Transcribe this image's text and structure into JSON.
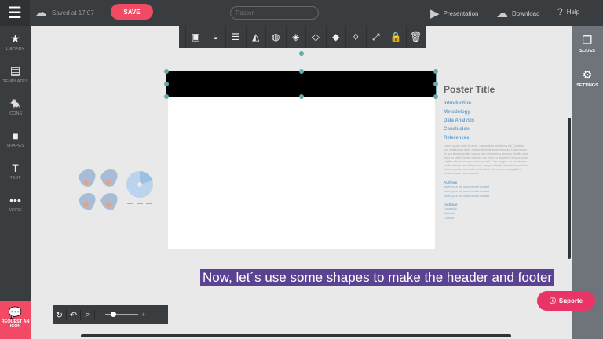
{
  "topbar": {
    "saved": "Saved at 17:07",
    "save": "SAVE",
    "title_placeholder": "Poster",
    "presentation": "Presentation",
    "download": "Download",
    "help": "Help"
  },
  "left_sidebar": [
    {
      "label": "LIBRARY",
      "icon": "★"
    },
    {
      "label": "TEMPLATES",
      "icon": "▤"
    },
    {
      "label": "ICONS",
      "icon": "🐁"
    },
    {
      "label": "SHAPES",
      "icon": "■"
    },
    {
      "label": "TEXT",
      "icon": "T"
    },
    {
      "label": "MORE",
      "icon": "•••"
    }
  ],
  "request_icon": "REQUEST AN ICON",
  "right_sidebar": [
    {
      "label": "SLIDES",
      "icon": "❐"
    },
    {
      "label": "SETTINGS",
      "icon": "⚙"
    }
  ],
  "toolbar_icons": [
    "image-icon",
    "fill-icon",
    "border-icon",
    "flip-icon",
    "opacity-icon",
    "bring-front-icon",
    "bring-forward-icon",
    "send-backward-icon",
    "send-back-icon",
    "resize-icon",
    "lock-icon",
    "delete-icon"
  ],
  "poster": {
    "title": "Poster Title",
    "sections": [
      "Introduction",
      "Metodology",
      "Data Analysis",
      "Conclusion",
      "References"
    ],
    "body": "Lorem ipsum dolor sit amet, consectetur adipiscing elit. Curabitur non malesuada dolor. Suspendisse sit amet ex turpis. Duis congue, mi non tempor mollis, massa sem dictum eros, tempus fringilla diam dolor eu tortor. Donec egestas nec enim eu tincidunt. Nunc nunc mi, sagittis a tincidunt quis, varius at velit. Duis congue, mi non tempor mollis, massa sem dictum eros, tempus fringilla diam dolor eu tortor. Donec egestas nec enim eu tincidunt. Nunc nunc mi, sagittis a tincidunt quis, varius at velit.",
    "authors_label": "Authors",
    "authors": [
      "Insert your full name/email contact",
      "Insert your full name/email contact",
      "Insert your full name/email contact"
    ],
    "institute_label": "Institute",
    "institute": [
      "University",
      "Address",
      "Contact"
    ]
  },
  "caption": "Now, let´s use some shapes to make the header and footer",
  "support": "Suporte",
  "zoom_level": 0.2
}
